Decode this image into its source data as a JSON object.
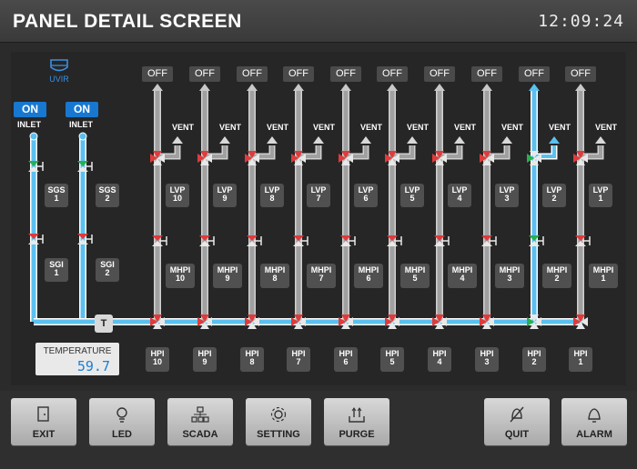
{
  "header": {
    "title": "PANEL DETAIL SCREEN",
    "clock": "12:09:24"
  },
  "colors": {
    "pipe_active": "#5bc0f0",
    "pipe_idle": "#a0a0a0",
    "valve_open": "#27b050",
    "valve_closed": "#e03a3a",
    "on_button": "#1878d0"
  },
  "inlets": [
    {
      "toggle": "ON",
      "label": "INLET",
      "sgs": "SGS\n1",
      "sgi": "SGI\n1"
    },
    {
      "toggle": "ON",
      "label": "INLET",
      "sgs": "SGS\n2",
      "sgi": "SGI\n2"
    }
  ],
  "uvir": {
    "label": "UVIR",
    "icon": "uvir-sensor-icon"
  },
  "temperature": {
    "label": "TEMPERATURE",
    "value": "59.7"
  },
  "tee_label": "T",
  "lines": [
    {
      "off": "OFF",
      "vent": "VENT",
      "lvp": "LVP\n10",
      "mhpi": "MHPI\n10",
      "hpi": "HPI\n10",
      "active": false,
      "lvp_state": "closed",
      "hpi_state": "closed"
    },
    {
      "off": "OFF",
      "vent": "VENT",
      "lvp": "LVP\n9",
      "mhpi": "MHPI\n9",
      "hpi": "HPI\n9",
      "active": false,
      "lvp_state": "closed",
      "hpi_state": "closed"
    },
    {
      "off": "OFF",
      "vent": "VENT",
      "lvp": "LVP\n8",
      "mhpi": "MHPI\n8",
      "hpi": "HPI\n8",
      "active": false,
      "lvp_state": "closed",
      "hpi_state": "closed"
    },
    {
      "off": "OFF",
      "vent": "VENT",
      "lvp": "LVP\n7",
      "mhpi": "MHPI\n7",
      "hpi": "HPI\n7",
      "active": false,
      "lvp_state": "closed",
      "hpi_state": "closed"
    },
    {
      "off": "OFF",
      "vent": "VENT",
      "lvp": "LVP\n6",
      "mhpi": "MHPI\n6",
      "hpi": "HPI\n6",
      "active": false,
      "lvp_state": "closed",
      "hpi_state": "closed"
    },
    {
      "off": "OFF",
      "vent": "VENT",
      "lvp": "LVP\n5",
      "mhpi": "MHPI\n5",
      "hpi": "HPI\n5",
      "active": false,
      "lvp_state": "closed",
      "hpi_state": "closed"
    },
    {
      "off": "OFF",
      "vent": "VENT",
      "lvp": "LVP\n4",
      "mhpi": "MHPI\n4",
      "hpi": "HPI\n4",
      "active": false,
      "lvp_state": "closed",
      "hpi_state": "closed"
    },
    {
      "off": "OFF",
      "vent": "VENT",
      "lvp": "LVP\n3",
      "mhpi": "MHPI\n3",
      "hpi": "HPI\n3",
      "active": false,
      "lvp_state": "closed",
      "hpi_state": "closed"
    },
    {
      "off": "OFF",
      "vent": "VENT",
      "lvp": "LVP\n2",
      "mhpi": "MHPI\n2",
      "hpi": "HPI\n2",
      "active": true,
      "lvp_state": "open",
      "hpi_state": "open"
    },
    {
      "off": "OFF",
      "vent": "VENT",
      "lvp": "LVP\n1",
      "mhpi": "MHPI\n1",
      "hpi": "HPI\n1",
      "active": false,
      "lvp_state": "closed",
      "hpi_state": "closed"
    }
  ],
  "footer": {
    "exit": "EXIT",
    "led": "LED",
    "scada": "SCADA",
    "setting": "SETTING",
    "purge": "PURGE",
    "quit": "QUIT",
    "alarm": "ALARM"
  }
}
